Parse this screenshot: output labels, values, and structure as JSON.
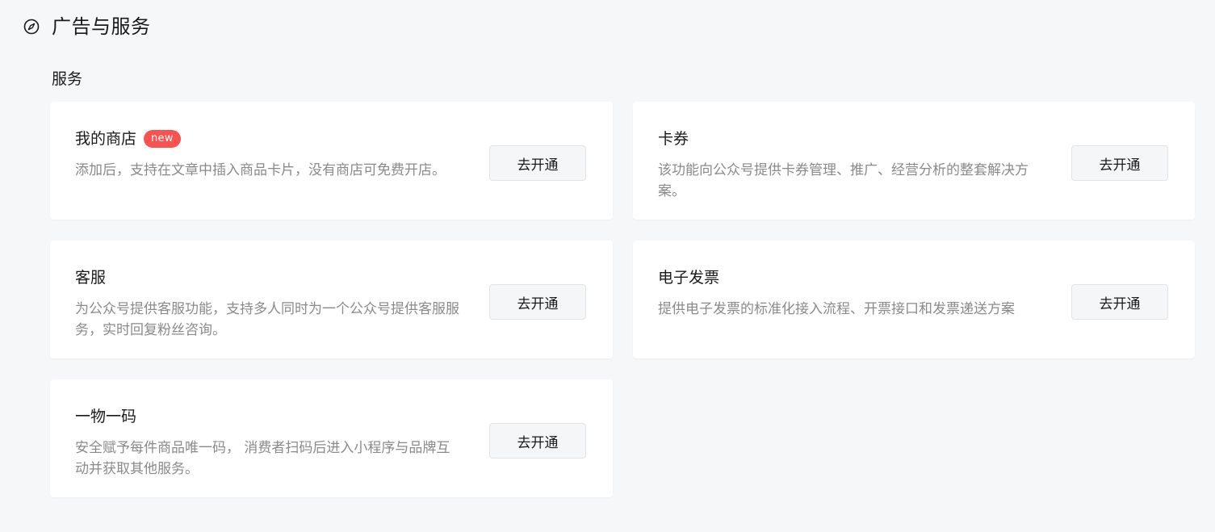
{
  "section": {
    "icon": "compass-icon",
    "title": "广告与服务"
  },
  "group": {
    "label": "服务"
  },
  "cards": {
    "shop": {
      "title": "我的商店",
      "badge": "new",
      "desc": "添加后，支持在文章中插入商品卡片，没有商店可免费开店。",
      "button": "去开通"
    },
    "coupon": {
      "title": "卡券",
      "desc": "该功能向公众号提供卡券管理、推广、经营分析的整套解决方案。",
      "button": "去开通"
    },
    "service": {
      "title": "客服",
      "desc": "为公众号提供客服功能，支持多人同时为一个公众号提供客服服务，实时回复粉丝咨询。",
      "button": "去开通"
    },
    "invoice": {
      "title": "电子发票",
      "desc": "提供电子发票的标准化接入流程、开票接口和发票递送方案",
      "button": "去开通"
    },
    "code": {
      "title": "一物一码",
      "desc": "安全赋予每件商品唯一码， 消费者扫码后进入小程序与品牌互动并获取其他服务。",
      "button": "去开通"
    }
  },
  "colors": {
    "background": "#f6f7f9",
    "card": "#ffffff",
    "badge": "#fa5151",
    "muted_text": "#8a8a8a",
    "button_bg": "#f5f6f7"
  }
}
